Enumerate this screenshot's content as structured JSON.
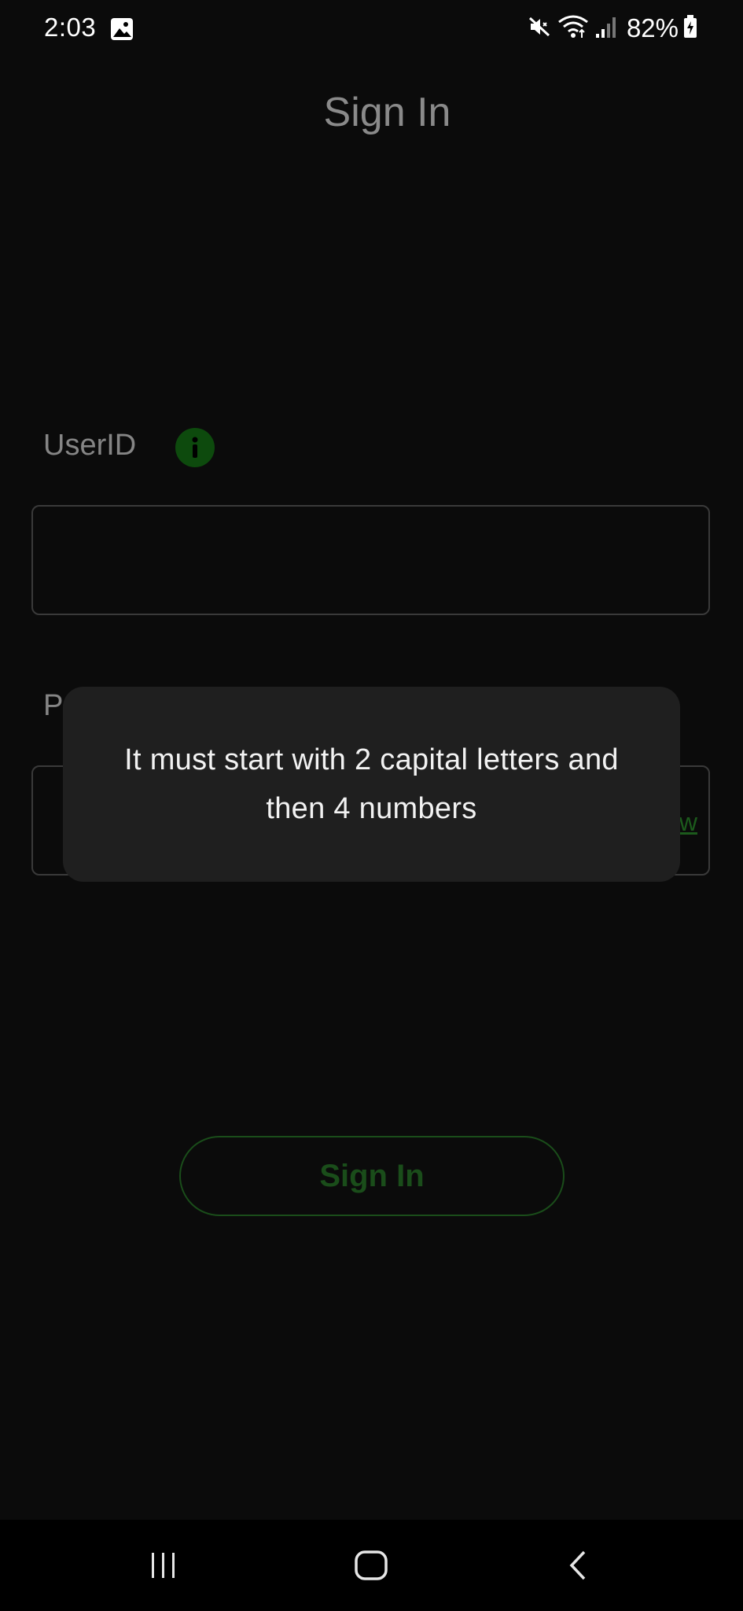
{
  "status_bar": {
    "time": "2:03",
    "battery": "82%",
    "icons": [
      "gallery-icon",
      "mute-icon",
      "wifi-icon",
      "signal-icon",
      "battery-charging-icon"
    ]
  },
  "header": {
    "title": "Sign In"
  },
  "form": {
    "userid_label": "UserID",
    "userid_value": "",
    "password_label_visible": "P",
    "show_toggle_visible": "w"
  },
  "sign_in_button": {
    "label": "Sign In"
  },
  "toast": {
    "message": "It must start with 2 capital letters and then 4 numbers"
  },
  "nav_bar": {
    "buttons": [
      "recents-icon",
      "home-icon",
      "back-icon"
    ]
  },
  "colors": {
    "background": "#0b0b0b",
    "accent": "#1a4d1a",
    "info_icon": "#0d4a0d",
    "toast_bg": "#1f1f1f"
  }
}
